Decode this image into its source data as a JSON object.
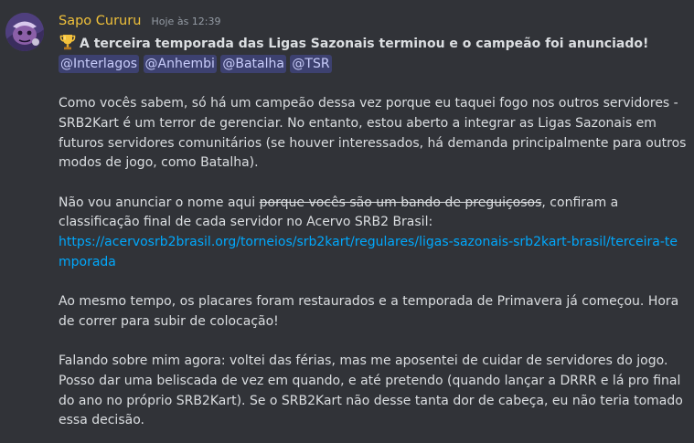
{
  "message": {
    "username": "Sapo Cururu",
    "timestamp": "Hoje às 12:39",
    "title_emoji": "trophy-icon",
    "title": "A terceira temporada das Ligas Sazonais terminou e o campeão foi anunciado!",
    "mentions": [
      "@Interlagos",
      "@Anhembi",
      "@Batalha",
      "@TSR"
    ],
    "paragraph1": "Como vocês sabem, só há um campeão dessa vez porque eu taquei fogo nos outros servidores - SRB2Kart é um terror de gerenciar. No entanto, estou aberto a integrar as Ligas Sazonais em futuros servidores comunitários (se houver interessados, há demanda principalmente para outros modos de jogo, como Batalha).",
    "paragraph2_start": "Não vou anunciar o nome aqui ",
    "paragraph2_strike": "porque vocês são um bando de preguiçosos",
    "paragraph2_end": ", confiram a classificação final de cada servidor no Acervo SRB2 Brasil:",
    "link": "https://acervosrb2brasil.org/torneios/srb2kart/regulares/ligas-sazonais-srb2kart-brasil/terceira-temporada",
    "paragraph3": "Ao mesmo tempo, os placares foram restaurados e a temporada de Primavera já começou. Hora de correr para subir de colocação!",
    "paragraph4": "Falando sobre mim agora: voltei das férias, mas me aposentei de cuidar de servidores do jogo. Posso dar uma beliscada de vez em quando, e até pretendo (quando lançar a DRRR e lá pro final do ano no próprio SRB2Kart). Se o SRB2Kart não desse tanta dor de cabeça, eu não teria tomado essa decisão."
  },
  "colors": {
    "background": "#313338",
    "username": "#f0c13a",
    "text": "#dbdee1",
    "timestamp": "#949ba4",
    "link": "#00a8fc",
    "mention_bg": "#3c4270",
    "mention_text": "#c9cdfb"
  }
}
